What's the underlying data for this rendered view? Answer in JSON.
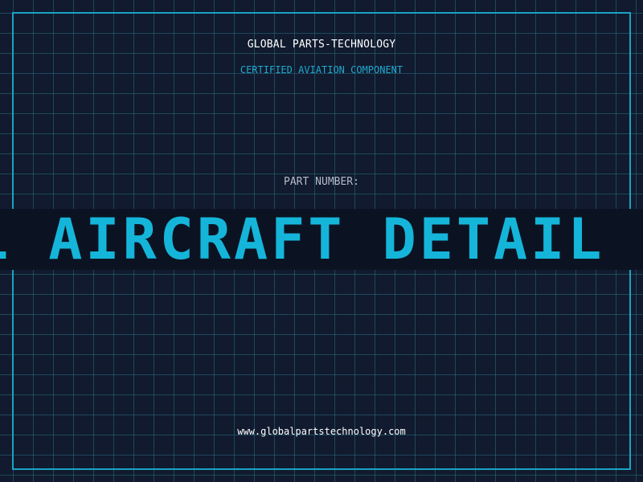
{
  "header": {
    "company": "GLOBAL PARTS-TECHNOLOGY",
    "tagline": "CERTIFIED AVIATION COMPONENT"
  },
  "part": {
    "label": "PART NUMBER:",
    "value": "L AIRCRAFT DETAIL F"
  },
  "footer": {
    "url": "www.globalpartstechnology.com"
  },
  "colors": {
    "background": "#111a2e",
    "accent": "#1aa3c4",
    "marquee_text": "#15b5da",
    "band": "#0b1322"
  }
}
